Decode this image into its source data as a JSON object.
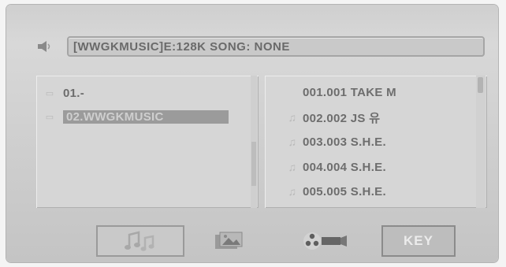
{
  "status": {
    "text": "[WWGKMUSIC]E:128K SONG: NONE",
    "icon": "speaker-icon"
  },
  "folders": [
    {
      "label": "01.-",
      "icon": "folder-icon",
      "selected": false
    },
    {
      "label": "02.WWGKMUSIC",
      "icon": "folder-icon",
      "selected": true
    }
  ],
  "songs": [
    {
      "label": "001.001 TAKE M",
      "icon": ""
    },
    {
      "label": "002.002 JS 유",
      "icon": "music-note-icon"
    },
    {
      "label": "003.003 S.H.E.",
      "icon": "music-note-icon"
    },
    {
      "label": "004.004 S.H.E.",
      "icon": "music-note-icon"
    },
    {
      "label": "005.005 S.H.E.",
      "icon": "music-note-icon"
    }
  ],
  "buttons": {
    "music_icon": "music-notes-icon",
    "photo_icon": "photo-icon",
    "video_icon": "film-reel-icon",
    "key_label": "KEY"
  },
  "colors": {
    "background": "#cfcfcf",
    "panel": "#d6d6d6",
    "text": "#6c6c6c",
    "selection": "#9b9b9b"
  }
}
